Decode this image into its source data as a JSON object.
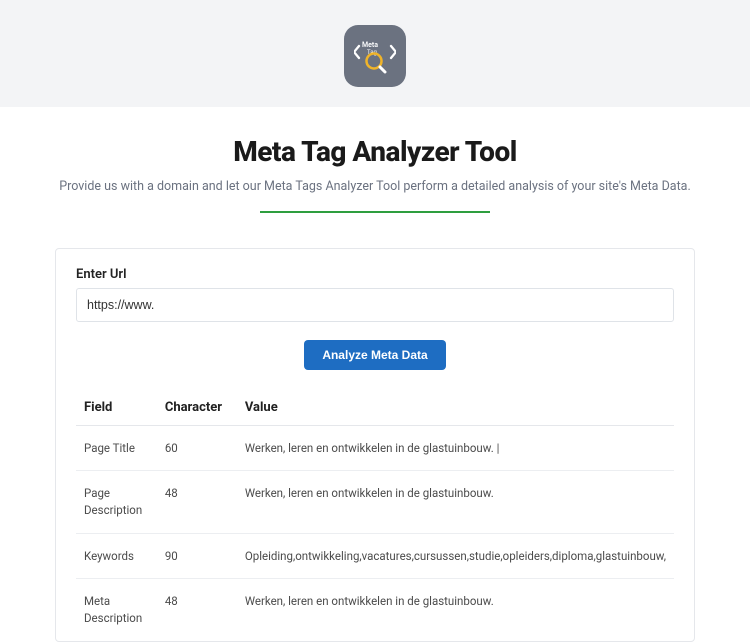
{
  "header": {
    "logo_label": "Meta Tag",
    "title": "Meta Tag Analyzer Tool",
    "subtitle": "Provide us with a domain and let our Meta Tags Analyzer Tool perform a detailed analysis of your site's Meta Data."
  },
  "form": {
    "url_label": "Enter Url",
    "url_value": "https://www.",
    "analyze_button": "Analyze Meta Data"
  },
  "table": {
    "headers": {
      "field": "Field",
      "character": "Character",
      "value": "Value"
    },
    "rows": [
      {
        "field": "Page Title",
        "character": "60",
        "value": "Werken, leren en ontwikkelen in de glastuinbouw. |"
      },
      {
        "field": "Page Description",
        "character": "48",
        "value": "Werken, leren en ontwikkelen in de glastuinbouw."
      },
      {
        "field": "Keywords",
        "character": "90",
        "value": "Opleiding,ontwikkeling,vacatures,cursussen,studie,opleiders,diploma,glastuinbouw,"
      },
      {
        "field": "Meta Description",
        "character": "48",
        "value": "Werken, leren en ontwikkelen in de glastuinbouw."
      }
    ]
  }
}
